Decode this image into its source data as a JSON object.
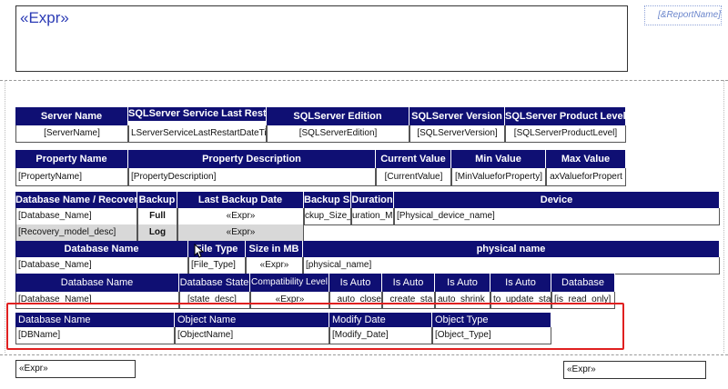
{
  "header": {
    "title": "«Expr»",
    "report_name": "[&ReportName]"
  },
  "server_table": {
    "headers": [
      "Server Name",
      "SQLServer Service Last Restart Date Time",
      "SQLServer Edition",
      "SQLServer Version",
      "SQLServer Product Level"
    ],
    "row": [
      "[ServerName]",
      "LServerServiceLastRestartDateTi",
      "[SQLServerEdition]",
      "[SQLServerVersion]",
      "[SQLServerProductLevel]"
    ]
  },
  "property_table": {
    "headers": [
      "Property Name",
      "Property Description",
      "Current Value",
      "Min Value",
      "Max Value"
    ],
    "row": [
      "[PropertyName]",
      "[PropertyDescription]",
      "[CurrentValue]",
      "[MinValueforProperty]",
      "axValueforPropert"
    ]
  },
  "backup_table": {
    "headers": [
      "Database Name / Recovery",
      "Backup",
      "Last Backup Date",
      "Backup Si",
      "Duration",
      "Device"
    ],
    "rows": [
      [
        "[Database_Name]",
        "Full",
        "«Expr»",
        "ckup_Size_",
        "uration_Mi",
        "[Physical_device_name]"
      ],
      [
        "[Recovery_model_desc]",
        "Log",
        "«Expr»",
        "",
        "",
        ""
      ]
    ]
  },
  "file_table": {
    "headers": [
      "Database Name",
      "File Type",
      "Size in MB",
      "physical name"
    ],
    "row": [
      "[Database_Name]",
      "[File_Type]",
      "«Expr»",
      "[physical_name]"
    ]
  },
  "state_table": {
    "headers": [
      "Database Name",
      "Database State",
      "Compatibility Level",
      "Is Auto",
      "Is Auto",
      "Is Auto",
      "Is Auto",
      "Database"
    ],
    "row": [
      "[Database_Name]",
      "[state_desc]",
      "«Expr»",
      "_auto_close_",
      "_create_sta",
      "auto_shrink_o",
      "to_update_stat",
      "[is_read_only]"
    ]
  },
  "object_table": {
    "headers": [
      "Database Name",
      "Object Name",
      "Modify Date",
      "Object Type"
    ],
    "row": [
      "[DBName]",
      "[ObjectName]",
      "[Modify_Date]",
      "[Object_Type]"
    ]
  },
  "footer": {
    "left": "«Expr»",
    "right": "«Expr»"
  }
}
